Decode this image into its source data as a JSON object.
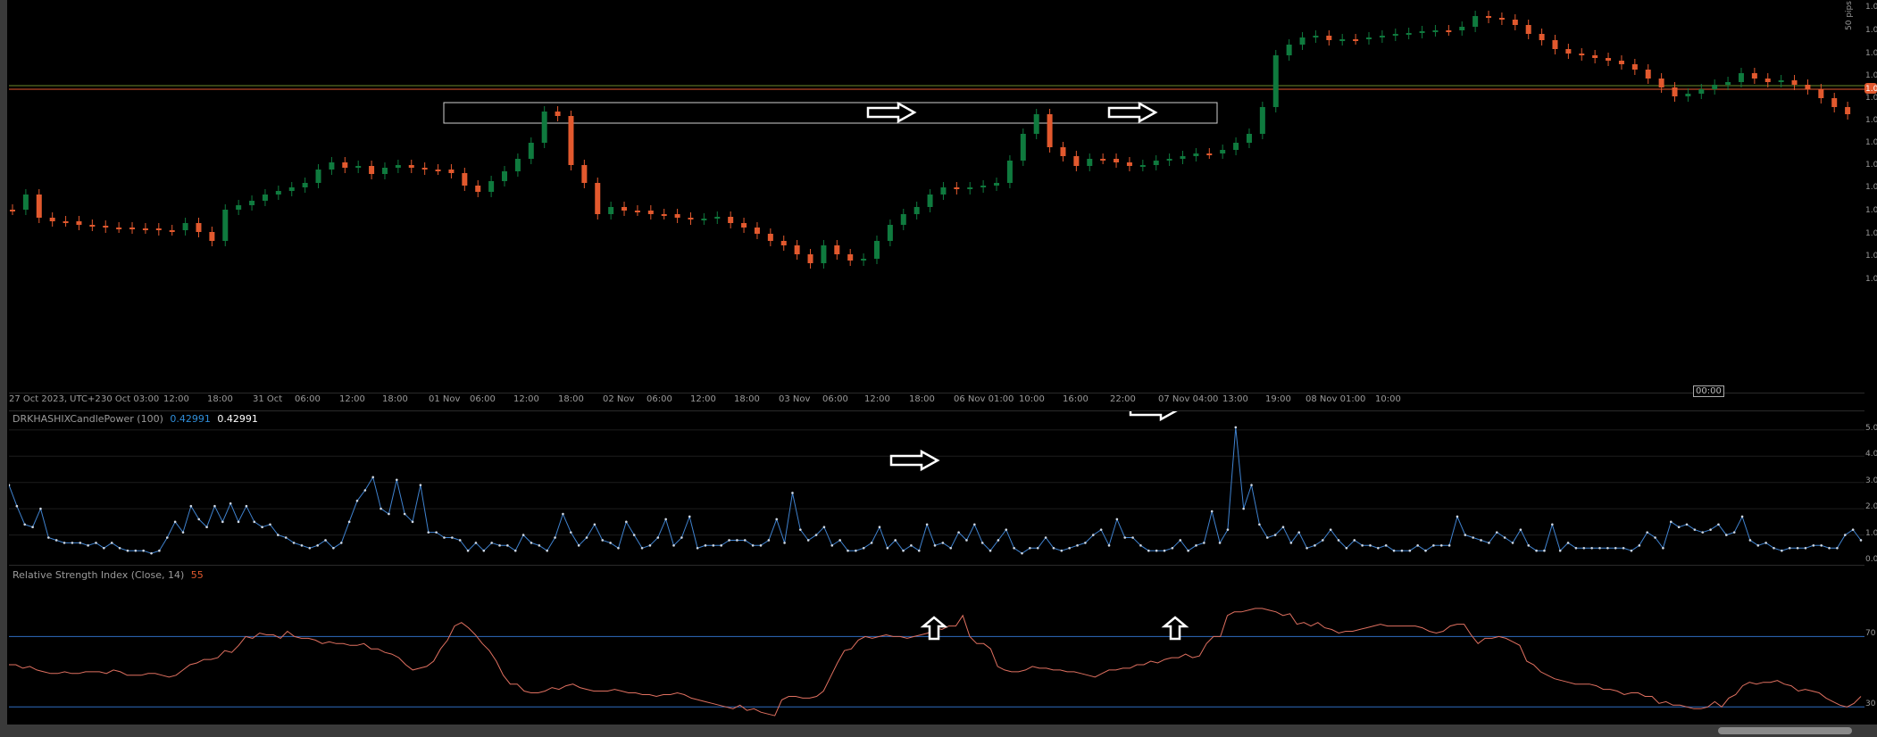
{
  "colors": {
    "bull": "#0f7a3e",
    "bear": "#e2592e",
    "cpi_line": "#3f82cf",
    "rsi_line": "#e07060",
    "rsi_levels": "#2f6cc0",
    "price_line_orange": "#e2592e",
    "price_line_green": "#6d8a2c",
    "zone_box": "#d0d0d0",
    "marker_arrow": "#ffffff",
    "label_highlight": "#2f8dd8",
    "rsi_value": "#e2592e"
  },
  "price_axis": {
    "scale_label": "50 pips",
    "tick_label": "1.0",
    "current_price_label": "1.0"
  },
  "time_axis": {
    "labels": [
      "27 Oct 2023, UTC+2",
      "30 Oct 03:00",
      "12:00",
      "18:00",
      "31 Oct",
      "06:00",
      "12:00",
      "18:00",
      "01 Nov",
      "06:00",
      "12:00",
      "18:00",
      "02 Nov",
      "06:00",
      "12:00",
      "18:00",
      "03 Nov",
      "06:00",
      "12:00",
      "18:00",
      "06 Nov 01:00",
      "10:00",
      "16:00",
      "22:00",
      "07 Nov 04:00",
      "13:00",
      "19:00",
      "08 Nov 01:00",
      "10:00"
    ],
    "cursor_label": "00:00"
  },
  "indicators": {
    "cpi": {
      "name": "DRKHASHIXCandlePower (100)",
      "value": "0.42991",
      "value2": "0.42991",
      "axis_ticks": [
        "5.0",
        "4.0",
        "3.0",
        "2.0",
        "1.0",
        "0.0"
      ],
      "values": [
        2.9,
        2.1,
        1.4,
        1.3,
        2.0,
        0.9,
        0.8,
        0.7,
        0.7,
        0.7,
        0.6,
        0.7,
        0.5,
        0.7,
        0.5,
        0.4,
        0.4,
        0.4,
        0.3,
        0.4,
        0.9,
        1.5,
        1.1,
        2.1,
        1.6,
        1.3,
        2.1,
        1.5,
        2.2,
        1.5,
        2.1,
        1.5,
        1.3,
        1.4,
        1.0,
        0.9,
        0.7,
        0.6,
        0.5,
        0.6,
        0.8,
        0.5,
        0.7,
        1.5,
        2.3,
        2.7,
        3.2,
        2.0,
        1.8,
        3.1,
        1.8,
        1.5,
        2.9,
        1.1,
        1.1,
        0.9,
        0.9,
        0.8,
        0.4,
        0.7,
        0.4,
        0.7,
        0.6,
        0.6,
        0.4,
        1.0,
        0.7,
        0.6,
        0.4,
        0.9,
        1.8,
        1.1,
        0.6,
        0.9,
        1.4,
        0.8,
        0.7,
        0.5,
        1.5,
        1.0,
        0.5,
        0.6,
        0.9,
        1.6,
        0.6,
        0.9,
        1.7,
        0.5,
        0.6,
        0.6,
        0.6,
        0.8,
        0.8,
        0.8,
        0.6,
        0.6,
        0.8,
        1.6,
        0.7,
        2.6,
        1.2,
        0.8,
        1.0,
        1.3,
        0.6,
        0.8,
        0.4,
        0.4,
        0.5,
        0.7,
        1.3,
        0.5,
        0.8,
        0.4,
        0.6,
        0.4,
        1.4,
        0.6,
        0.7,
        0.5,
        1.1,
        0.8,
        1.4,
        0.7,
        0.4,
        0.8,
        1.2,
        0.5,
        0.3,
        0.5,
        0.5,
        0.9,
        0.5,
        0.4,
        0.5,
        0.6,
        0.7,
        1.0,
        1.2,
        0.6,
        1.6,
        0.9,
        0.9,
        0.6,
        0.4,
        0.4,
        0.4,
        0.5,
        0.8,
        0.4,
        0.6,
        0.7,
        1.9,
        0.7,
        1.2,
        5.1,
        2.0,
        2.9,
        1.4,
        0.9,
        1.0,
        1.3,
        0.7,
        1.1,
        0.5,
        0.6,
        0.8,
        1.2,
        0.8,
        0.5,
        0.8,
        0.6,
        0.6,
        0.5,
        0.6,
        0.4,
        0.4,
        0.4,
        0.6,
        0.4,
        0.6,
        0.6,
        0.6,
        1.7,
        1.0,
        0.9,
        0.8,
        0.7,
        1.1,
        0.9,
        0.7,
        1.2,
        0.6,
        0.4,
        0.4,
        1.4,
        0.4,
        0.7,
        0.5,
        0.5,
        0.5,
        0.5,
        0.5,
        0.5,
        0.5,
        0.4,
        0.6,
        1.1,
        0.9,
        0.5,
        1.5,
        1.3,
        1.4,
        1.2,
        1.1,
        1.2,
        1.4,
        1.0,
        1.1,
        1.7,
        0.8,
        0.6,
        0.7,
        0.5,
        0.4,
        0.5,
        0.5,
        0.5,
        0.6,
        0.6,
        0.5,
        0.5,
        1.0,
        1.2,
        0.8
      ]
    },
    "rsi": {
      "name": "Relative Strength Index (Close, 14)",
      "value": "55",
      "axis_ticks": [
        "70",
        "30"
      ],
      "levels": [
        70,
        30
      ],
      "values": [
        54,
        54,
        52,
        53,
        51,
        50,
        49,
        49,
        50,
        49,
        49,
        50,
        50,
        50,
        49,
        51,
        50,
        48,
        48,
        48,
        49,
        49,
        48,
        47,
        48,
        51,
        54,
        55,
        57,
        57,
        58,
        62,
        61,
        65,
        70,
        69,
        72,
        71,
        71,
        69,
        73,
        70,
        69,
        69,
        68,
        66,
        67,
        66,
        66,
        65,
        65,
        66,
        63,
        63,
        61,
        60,
        58,
        54,
        51,
        52,
        53,
        56,
        63,
        68,
        76,
        78,
        75,
        71,
        66,
        62,
        56,
        48,
        43,
        43,
        39,
        38,
        38,
        39,
        41,
        40,
        42,
        43,
        41,
        40,
        39,
        39,
        39,
        40,
        39,
        38,
        38,
        37,
        37,
        36,
        37,
        37,
        38,
        37,
        35,
        34,
        33,
        32,
        31,
        30,
        29,
        31,
        28,
        29,
        27,
        26,
        25,
        34,
        36,
        36,
        35,
        35,
        36,
        39,
        47,
        55,
        62,
        63,
        68,
        70,
        69,
        70,
        71,
        70,
        70,
        69,
        70,
        71,
        72,
        75,
        74,
        76,
        76,
        82,
        70,
        66,
        66,
        63,
        53,
        51,
        50,
        50,
        51,
        53,
        52,
        52,
        51,
        51,
        50,
        50,
        49,
        48,
        47,
        49,
        51,
        51,
        52,
        52,
        54,
        54,
        56,
        55,
        57,
        58,
        58,
        60,
        58,
        59,
        66,
        70,
        70,
        82,
        84,
        84,
        85,
        86,
        86,
        85,
        84,
        82,
        83,
        77,
        78,
        76,
        78,
        75,
        74,
        72,
        73,
        73,
        74,
        75,
        76,
        77,
        76,
        76,
        76,
        76,
        76,
        75,
        73,
        72,
        73,
        76,
        77,
        77,
        71,
        66,
        69,
        69,
        70,
        69,
        67,
        65,
        56,
        54,
        50,
        48,
        46,
        45,
        44,
        43,
        43,
        43,
        42,
        40,
        40,
        39,
        37,
        38,
        38,
        36,
        36,
        32,
        33,
        31,
        31,
        30,
        29,
        29,
        30,
        33,
        30,
        35,
        37,
        42,
        44,
        43,
        44,
        44,
        45,
        43,
        42,
        39,
        40,
        39,
        38,
        35,
        33,
        31,
        30,
        32,
        36
      ]
    }
  },
  "marker_labels": {
    "zone": "resistance zone",
    "arrows": "white arrows"
  }
}
